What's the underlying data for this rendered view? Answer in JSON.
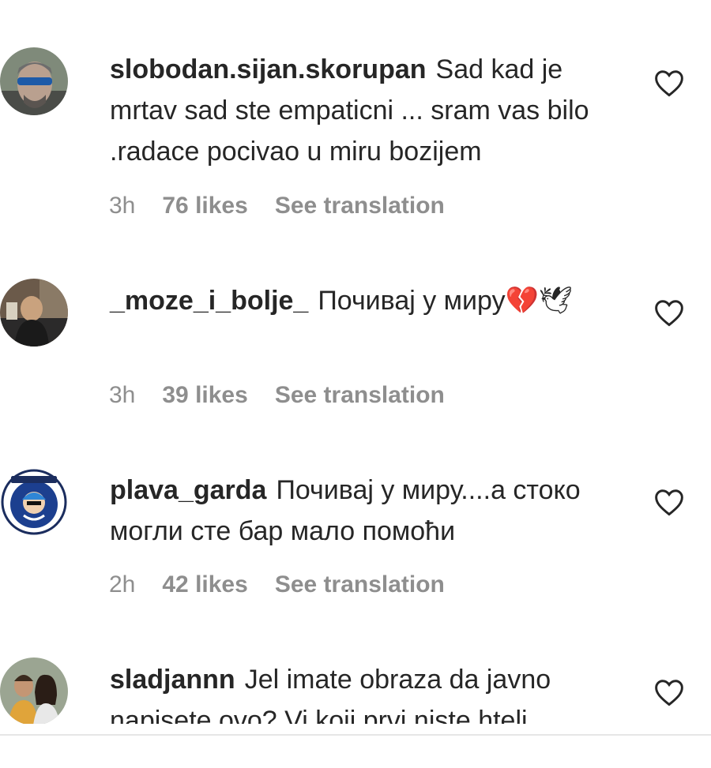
{
  "comments": [
    {
      "username": "slobodan.sijan.skorupan",
      "text": "Sad kad je mrtav sad ste empaticni ... sram vas bilo .radace pocivao u miru bozijem",
      "time": "3h",
      "likes": "76 likes",
      "translate": "See translation"
    },
    {
      "username": "_moze_i_bolje_",
      "text": "Почивај у миру💔🕊",
      "time": "3h",
      "likes": "39 likes",
      "translate": "See translation"
    },
    {
      "username": "plava_garda",
      "text": "Почивај у миру....а стоко могли сте бар мало помоћи",
      "time": "2h",
      "likes": "42 likes",
      "translate": "See translation"
    },
    {
      "username": "sladjannn",
      "text": "Jel imate obraza da javno napisete ovo? Vi koji prvi niste hteli",
      "time": "",
      "likes": "",
      "translate": ""
    }
  ],
  "icons": {
    "like": "heart-outline-icon"
  }
}
